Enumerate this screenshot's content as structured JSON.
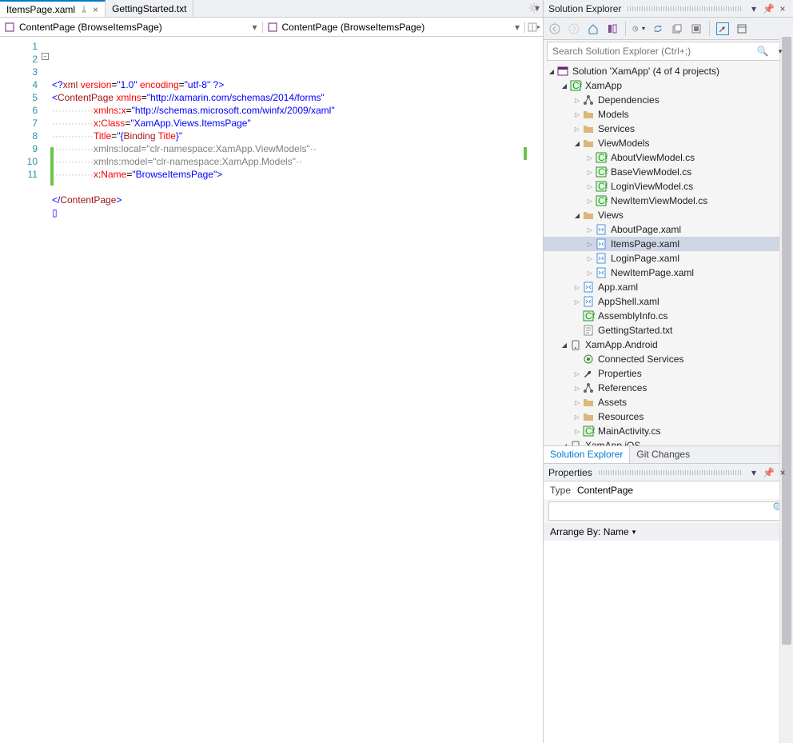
{
  "tabs": [
    {
      "label": "ItemsPage.xaml",
      "active": true
    },
    {
      "label": "GettingStarted.txt",
      "active": false
    }
  ],
  "crumbs": {
    "left": "ContentPage (BrowseItemsPage)",
    "right": "ContentPage (BrowseItemsPage)"
  },
  "code_tokens": [
    [
      {
        "c": "t-blue",
        "t": "<?"
      },
      {
        "c": "t-brown",
        "t": "xml "
      },
      {
        "c": "t-attr",
        "t": "version"
      },
      {
        "c": "t-eq",
        "t": "="
      },
      {
        "c": "t-blue",
        "t": "\"1.0\" "
      },
      {
        "c": "t-attr",
        "t": "encoding"
      },
      {
        "c": "t-eq",
        "t": "="
      },
      {
        "c": "t-blue",
        "t": "\"utf-8\" "
      },
      {
        "c": "t-blue",
        "t": "?>"
      }
    ],
    [
      {
        "c": "t-blue",
        "t": "<"
      },
      {
        "c": "t-brown",
        "t": "ContentPage "
      },
      {
        "c": "t-attr",
        "t": "xmlns"
      },
      {
        "c": "t-eq",
        "t": "="
      },
      {
        "c": "t-blue",
        "t": "\"http://xamarin.com/schemas/2014/forms\""
      }
    ],
    [
      {
        "c": "t-dots",
        "t": "·············"
      },
      {
        "c": "t-attr",
        "t": "xmlns"
      },
      {
        "c": "t-eq",
        "t": ":"
      },
      {
        "c": "t-attr",
        "t": "x"
      },
      {
        "c": "t-eq",
        "t": "="
      },
      {
        "c": "t-blue",
        "t": "\"http://schemas.microsoft.com/winfx/2009/xaml\""
      }
    ],
    [
      {
        "c": "t-dots",
        "t": "·············"
      },
      {
        "c": "t-attr",
        "t": "x"
      },
      {
        "c": "t-eq",
        "t": ":"
      },
      {
        "c": "t-attr",
        "t": "Class"
      },
      {
        "c": "t-eq",
        "t": "="
      },
      {
        "c": "t-blue",
        "t": "\"XamApp.Views.ItemsPage\""
      }
    ],
    [
      {
        "c": "t-dots",
        "t": "·············"
      },
      {
        "c": "t-attr",
        "t": "Title"
      },
      {
        "c": "t-eq",
        "t": "="
      },
      {
        "c": "t-blue",
        "t": "\"{"
      },
      {
        "c": "t-brown",
        "t": "Binding "
      },
      {
        "c": "t-attr",
        "t": "Title"
      },
      {
        "c": "t-blue",
        "t": "}\""
      }
    ],
    [
      {
        "c": "t-dots",
        "t": "·············"
      },
      {
        "c": "t-gray",
        "t": "xmlns"
      },
      {
        "c": "t-gray",
        "t": ":"
      },
      {
        "c": "t-gray",
        "t": "local"
      },
      {
        "c": "t-gray",
        "t": "="
      },
      {
        "c": "t-gray",
        "t": "\"clr-namespace:XamApp.ViewModels\"··"
      }
    ],
    [
      {
        "c": "t-dots",
        "t": "·············"
      },
      {
        "c": "t-gray",
        "t": "xmlns"
      },
      {
        "c": "t-gray",
        "t": ":"
      },
      {
        "c": "t-gray",
        "t": "model"
      },
      {
        "c": "t-gray",
        "t": "="
      },
      {
        "c": "t-gray",
        "t": "\"clr-namespace:XamApp.Models\"··"
      }
    ],
    [
      {
        "c": "t-dots",
        "t": "·············"
      },
      {
        "c": "t-attr",
        "t": "x"
      },
      {
        "c": "t-eq",
        "t": ":"
      },
      {
        "c": "t-attr",
        "t": "Name"
      },
      {
        "c": "t-eq",
        "t": "="
      },
      {
        "c": "t-blue",
        "t": "\"BrowseItemsPage\""
      },
      {
        "c": "t-blue",
        "t": ">"
      }
    ],
    [],
    [
      {
        "c": "t-blue",
        "t": "</"
      },
      {
        "c": "t-brown",
        "t": "ContentPage"
      },
      {
        "c": "t-blue",
        "t": ">"
      }
    ],
    [
      {
        "c": "t-blue",
        "t": "▯"
      }
    ]
  ],
  "line_count": 11,
  "solution_explorer": {
    "title": "Solution Explorer",
    "search_placeholder": "Search Solution Explorer (Ctrl+;)",
    "tree": [
      {
        "d": 0,
        "a": "open",
        "i": "sln",
        "t": "Solution 'XamApp' (4 of 4 projects)"
      },
      {
        "d": 1,
        "a": "open",
        "i": "csproj",
        "t": "XamApp"
      },
      {
        "d": 2,
        "a": "closed",
        "i": "deps",
        "t": "Dependencies"
      },
      {
        "d": 2,
        "a": "closed",
        "i": "folder",
        "t": "Models"
      },
      {
        "d": 2,
        "a": "closed",
        "i": "folder",
        "t": "Services"
      },
      {
        "d": 2,
        "a": "open",
        "i": "folder",
        "t": "ViewModels"
      },
      {
        "d": 3,
        "a": "closed",
        "i": "cs",
        "t": "AboutViewModel.cs"
      },
      {
        "d": 3,
        "a": "closed",
        "i": "cs",
        "t": "BaseViewModel.cs"
      },
      {
        "d": 3,
        "a": "closed",
        "i": "cs",
        "t": "LoginViewModel.cs"
      },
      {
        "d": 3,
        "a": "closed",
        "i": "cs",
        "t": "NewItemViewModel.cs"
      },
      {
        "d": 2,
        "a": "open",
        "i": "folder",
        "t": "Views"
      },
      {
        "d": 3,
        "a": "closed",
        "i": "xaml",
        "t": "AboutPage.xaml"
      },
      {
        "d": 3,
        "a": "closed",
        "i": "xaml",
        "t": "ItemsPage.xaml",
        "sel": true
      },
      {
        "d": 3,
        "a": "closed",
        "i": "xaml",
        "t": "LoginPage.xaml"
      },
      {
        "d": 3,
        "a": "closed",
        "i": "xaml",
        "t": "NewItemPage.xaml"
      },
      {
        "d": 2,
        "a": "closed",
        "i": "xaml",
        "t": "App.xaml"
      },
      {
        "d": 2,
        "a": "closed",
        "i": "xaml",
        "t": "AppShell.xaml"
      },
      {
        "d": 2,
        "a": "none",
        "i": "cs",
        "t": "AssemblyInfo.cs"
      },
      {
        "d": 2,
        "a": "none",
        "i": "txt",
        "t": "GettingStarted.txt"
      },
      {
        "d": 1,
        "a": "open",
        "i": "android",
        "t": "XamApp.Android"
      },
      {
        "d": 2,
        "a": "none",
        "i": "conn",
        "t": "Connected Services"
      },
      {
        "d": 2,
        "a": "closed",
        "i": "wrench",
        "t": "Properties"
      },
      {
        "d": 2,
        "a": "closed",
        "i": "deps",
        "t": "References"
      },
      {
        "d": 2,
        "a": "closed",
        "i": "folder",
        "t": "Assets"
      },
      {
        "d": 2,
        "a": "closed",
        "i": "folder",
        "t": "Resources"
      },
      {
        "d": 2,
        "a": "closed",
        "i": "cs",
        "t": "MainActivity.cs"
      },
      {
        "d": 1,
        "a": "open",
        "i": "ios",
        "t": "XamApp.iOS"
      }
    ],
    "bottom_tabs": [
      {
        "label": "Solution Explorer",
        "active": true
      },
      {
        "label": "Git Changes",
        "active": false
      }
    ]
  },
  "properties": {
    "title": "Properties",
    "type_label": "Type",
    "type_value": "ContentPage",
    "arrange_by": "Arrange By: Name"
  }
}
